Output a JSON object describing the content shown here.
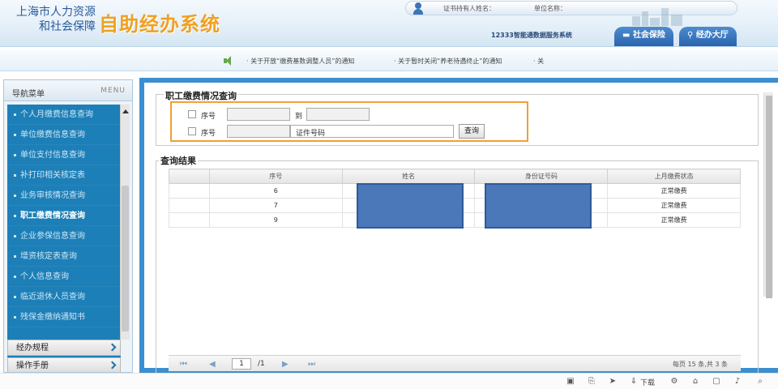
{
  "header": {
    "logo_line1": "上海市人力资源",
    "logo_line2": "和社会保障",
    "system_title": "自助经办系统",
    "cert_holder_label": "证书持有人姓名：",
    "unit_name_label": "单位名称：",
    "sys_12333": "12333智能通数据服务系统",
    "tab_social_insurance": "社会保险",
    "tab_service_hall": "经办大厅"
  },
  "notices": [
    "· 关于开放“缴费基数调整人员”的通知",
    "· 关于暂时关闭“养老待遇终止”的通知",
    "· 关"
  ],
  "sidebar": {
    "title": "导航菜单",
    "menu_label": "MENU",
    "items": [
      {
        "label": "个人月缴费信息查询",
        "active": false
      },
      {
        "label": "单位缴费信息查询",
        "active": false
      },
      {
        "label": "单位支付信息查询",
        "active": false
      },
      {
        "label": "补打印相关核定表",
        "active": false
      },
      {
        "label": "业务审核情况查询",
        "active": false
      },
      {
        "label": "职工缴费情况查询",
        "active": true
      },
      {
        "label": "企业参保信息查询",
        "active": false
      },
      {
        "label": "增资核定表查询",
        "active": false
      },
      {
        "label": "个人信息查询",
        "active": false
      },
      {
        "label": "临近退休人员查询",
        "active": false
      },
      {
        "label": "残保金缴纳通知书",
        "active": false
      }
    ],
    "section1": "经办规程",
    "section2": "操作手册"
  },
  "query": {
    "legend": "职工缴费情况查询",
    "row1_label": "序号",
    "to_label": "到",
    "row2_label": "序号",
    "id_label": "证件号码",
    "button": "查询"
  },
  "results": {
    "legend": "查询结果",
    "columns": [
      "",
      "序号",
      "姓名",
      "身份证号码",
      "上月缴费状态"
    ],
    "rows": [
      {
        "seq": "6",
        "name": "",
        "id": "",
        "status": "正常缴费"
      },
      {
        "seq": "7",
        "name": "",
        "id": "",
        "status": "正常缴费"
      },
      {
        "seq": "9",
        "name": "",
        "id": "",
        "status": "正常缴费"
      }
    ]
  },
  "pager": {
    "page_value": "1",
    "total_pages": "/1",
    "summary": "每页 15 条,共 3 条"
  },
  "toolbar": {
    "download_label": "下载"
  },
  "colors": {
    "accent_blue": "#3b8fd0",
    "sidebar_blue": "#1d7fb7",
    "title_orange": "#f0a020",
    "highlight_orange": "#f0a038",
    "mask_blue": "#4a78b8"
  }
}
